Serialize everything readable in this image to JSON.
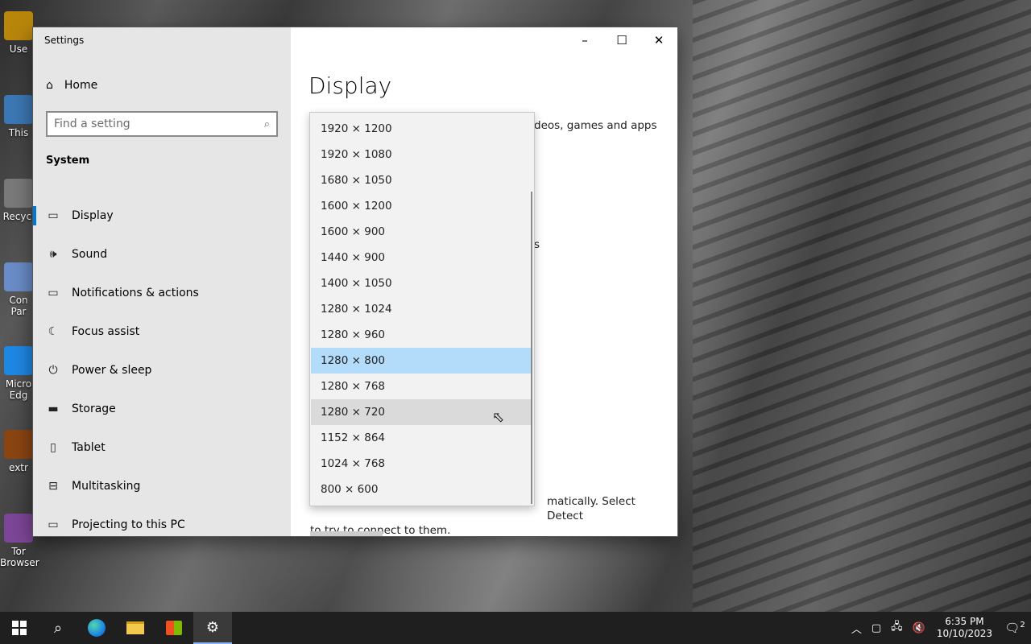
{
  "desktop": {
    "icons": [
      {
        "label": "Use",
        "color": "#b8860b"
      },
      {
        "label": "This",
        "color": "#3c78b4"
      },
      {
        "label": "Recycl",
        "color": "#7a7a7a"
      },
      {
        "label": "Con Par",
        "color": "#6a8cc8"
      },
      {
        "label": "Micro Edg",
        "color": "#1e88e5"
      },
      {
        "label": "extr",
        "color": "#8b4513"
      },
      {
        "label": "Tor Browser",
        "color": "#7d4698"
      }
    ]
  },
  "window": {
    "title": "Settings",
    "home_label": "Home",
    "search_placeholder": "Find a setting",
    "section_label": "System",
    "nav_items": [
      {
        "label": "Display",
        "icon": "monitor-icon"
      },
      {
        "label": "Sound",
        "icon": "speaker-icon"
      },
      {
        "label": "Notifications & actions",
        "icon": "notification-icon"
      },
      {
        "label": "Focus assist",
        "icon": "moon-icon"
      },
      {
        "label": "Power & sleep",
        "icon": "power-icon"
      },
      {
        "label": "Storage",
        "icon": "storage-icon"
      },
      {
        "label": "Tablet",
        "icon": "tablet-icon"
      },
      {
        "label": "Multitasking",
        "icon": "multitasking-icon"
      },
      {
        "label": "Projecting to this PC",
        "icon": "projecting-icon"
      }
    ],
    "active_nav": "Display",
    "page_title": "Display",
    "bg_text_1": "deos, games and apps",
    "bg_mark": "s",
    "bg_text_2": "matically. Select Detect",
    "bg_text_3": "to try to connect to them."
  },
  "resolution_dropdown": {
    "options": [
      "1920 × 1200",
      "1920 × 1080",
      "1680 × 1050",
      "1600 × 1200",
      "1600 × 900",
      "1440 × 900",
      "1400 × 1050",
      "1280 × 1024",
      "1280 × 960",
      "1280 × 800",
      "1280 × 768",
      "1280 × 720",
      "1152 × 864",
      "1024 × 768",
      "800 × 600"
    ],
    "selected": "1280 × 800",
    "hovered": "1280 × 720"
  },
  "taskbar": {
    "time": "6:35 PM",
    "date": "10/10/2023",
    "notification_count": "2"
  }
}
